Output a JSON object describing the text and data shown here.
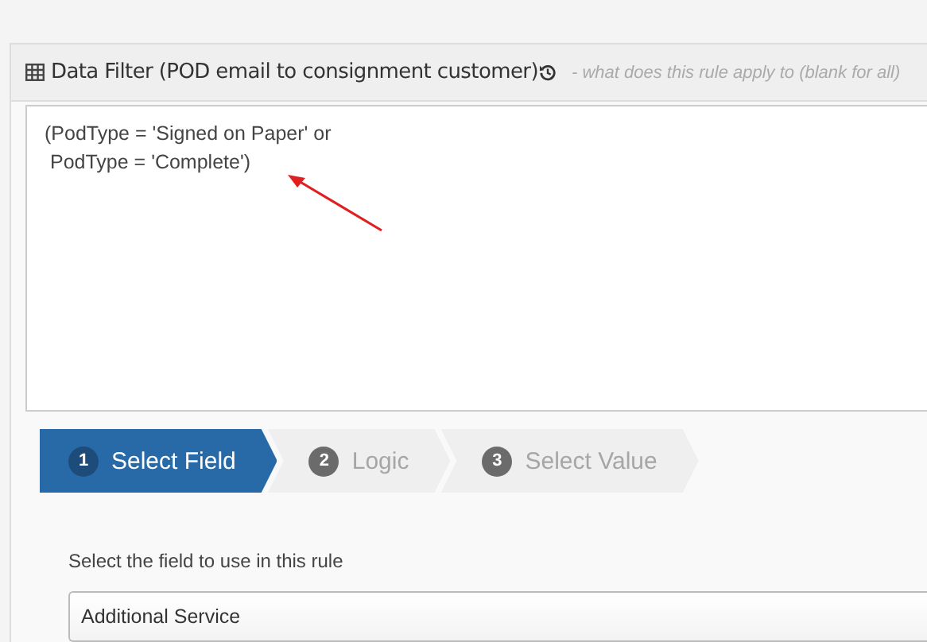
{
  "panel": {
    "title": "Data Filter (POD email to consignment customer)",
    "hint": "- what does this rule apply to (blank for all)"
  },
  "filter_text": "(PodType = 'Signed on Paper' or\n PodType = 'Complete')",
  "steps": [
    {
      "number": "1",
      "label": "Select Field",
      "selected": true
    },
    {
      "number": "2",
      "label": "Logic",
      "selected": false
    },
    {
      "number": "3",
      "label": "Select Value",
      "selected": false
    }
  ],
  "field_prompt": "Select the field to use in this rule",
  "field_select": {
    "value": "Additional Service"
  }
}
